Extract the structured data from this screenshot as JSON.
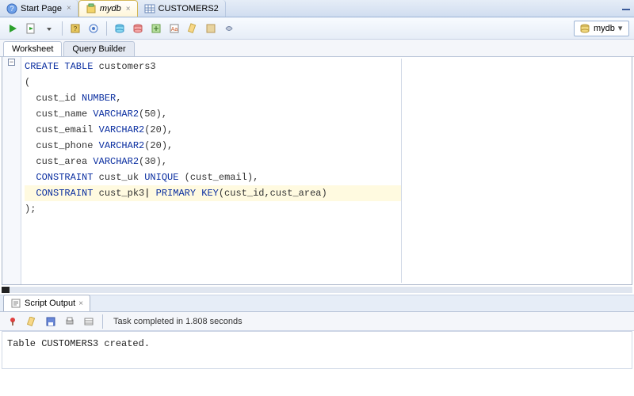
{
  "tabs": [
    {
      "label": "Start Page",
      "icon": "help"
    },
    {
      "label": "mydb",
      "icon": "db",
      "active": true
    },
    {
      "label": "CUSTOMERS2",
      "icon": "table"
    }
  ],
  "db_dropdown": {
    "label": "mydb"
  },
  "sub_tabs": [
    {
      "label": "Worksheet",
      "active": true
    },
    {
      "label": "Query Builder",
      "active": false
    }
  ],
  "code_lines": [
    {
      "t": [
        {
          "c": "kw",
          "v": "CREATE TABLE "
        },
        {
          "c": "ident",
          "v": "customers3"
        }
      ]
    },
    {
      "t": [
        {
          "c": "ident",
          "v": "("
        }
      ]
    },
    {
      "t": [
        {
          "c": "ident",
          "v": "  cust_id "
        },
        {
          "c": "dt",
          "v": "NUMBER"
        },
        {
          "c": "ident",
          "v": ","
        }
      ]
    },
    {
      "t": [
        {
          "c": "ident",
          "v": "  cust_name "
        },
        {
          "c": "dt",
          "v": "VARCHAR2"
        },
        {
          "c": "ident",
          "v": "(50),"
        }
      ]
    },
    {
      "t": [
        {
          "c": "ident",
          "v": "  cust_email "
        },
        {
          "c": "dt",
          "v": "VARCHAR2"
        },
        {
          "c": "ident",
          "v": "(20),"
        }
      ]
    },
    {
      "t": [
        {
          "c": "ident",
          "v": "  cust_phone "
        },
        {
          "c": "dt",
          "v": "VARCHAR2"
        },
        {
          "c": "ident",
          "v": "(20),"
        }
      ]
    },
    {
      "t": [
        {
          "c": "ident",
          "v": "  cust_area "
        },
        {
          "c": "dt",
          "v": "VARCHAR2"
        },
        {
          "c": "ident",
          "v": "(30),"
        }
      ]
    },
    {
      "t": [
        {
          "c": "ident",
          "v": "  "
        },
        {
          "c": "kw",
          "v": "CONSTRAINT"
        },
        {
          "c": "ident",
          "v": " cust_uk "
        },
        {
          "c": "kw",
          "v": "UNIQUE"
        },
        {
          "c": "ident",
          "v": " (cust_email),"
        }
      ]
    },
    {
      "t": [
        {
          "c": "ident",
          "v": "  "
        },
        {
          "c": "kw",
          "v": "CONSTRAINT"
        },
        {
          "c": "ident",
          "v": " cust_pk3"
        },
        {
          "c": "cursor",
          "v": "|"
        },
        {
          "c": "ident",
          "v": " "
        },
        {
          "c": "kw",
          "v": "PRIMARY KEY"
        },
        {
          "c": "ident",
          "v": "(cust_id,cust_area)"
        }
      ],
      "hl": true
    },
    {
      "t": [
        {
          "c": "ident",
          "v": ");"
        }
      ]
    }
  ],
  "output_tab": "Script Output",
  "output_status": "Task completed in 1.808 seconds",
  "output_body": "Table CUSTOMERS3 created.",
  "icons": {
    "run": "run",
    "scriptrun": "scriptrun",
    "commit": "commit",
    "rollback": "rollback",
    "dbnav": "dbnav",
    "explain": "explain",
    "autotrace": "autotrace",
    "sqlhist": "sqlhist",
    "format": "format",
    "clear": "clear",
    "minimize": "minimize"
  }
}
